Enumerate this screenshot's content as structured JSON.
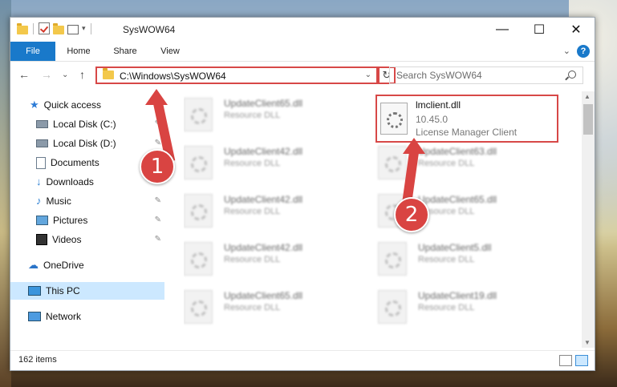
{
  "window": {
    "title": "SysWOW64",
    "minimize": "—",
    "maximize": "☐",
    "close": "✕"
  },
  "ribbon": {
    "tabs": [
      "File",
      "Home",
      "Share",
      "View"
    ],
    "expand": "⌄",
    "help": "?"
  },
  "nav": {
    "back": "←",
    "forward": "→",
    "up": "↑",
    "address": "C:\\Windows\\SysWOW64",
    "dropdown": "⌄",
    "refresh": "↻",
    "search_placeholder": "Search SysWOW64"
  },
  "sidebar": {
    "items": [
      {
        "label": "Quick access"
      },
      {
        "label": "Local Disk (C:)",
        "pinned": true
      },
      {
        "label": "Local Disk (D:)",
        "pinned": true
      },
      {
        "label": "Documents",
        "pinned": true
      },
      {
        "label": "Downloads",
        "pinned": true
      },
      {
        "label": "Music",
        "pinned": true
      },
      {
        "label": "Pictures",
        "pinned": true
      },
      {
        "label": "Videos",
        "pinned": true
      },
      {
        "label": "OneDrive"
      },
      {
        "label": "This PC",
        "selected": true
      },
      {
        "label": "Network"
      }
    ],
    "pin_glyph": "✎"
  },
  "files": {
    "left_column": [
      {
        "name": "UpdateClient65.dll",
        "type": "Resource DLL"
      },
      {
        "name": "UpdateClient42.dll",
        "type": "Resource DLL"
      },
      {
        "name": "UpdateClient42.dll",
        "type": "Resource DLL"
      },
      {
        "name": "UpdateClient42.dll",
        "type": "Resource DLL"
      },
      {
        "name": "UpdateClient65.dll",
        "type": "Resource DLL"
      }
    ],
    "right_column": [
      {
        "name": "UpdateClient63.dll",
        "type": "Resource DLL"
      },
      {
        "name": "UpdateClient65.dll",
        "type": "Resource DLL"
      },
      {
        "name": "UpdateClient5.dll",
        "type": "Resource DLL"
      },
      {
        "name": "UpdateClient19.dll",
        "type": "Resource DLL"
      }
    ],
    "highlighted": {
      "name": "lmclient.dll",
      "version": "10.45.0",
      "description": "License Manager Client"
    }
  },
  "status": {
    "count": "162 items"
  },
  "callouts": [
    "1",
    "2"
  ],
  "colors": {
    "accent": "#1979ca",
    "highlight": "#d74847",
    "selection": "#cce8ff"
  }
}
